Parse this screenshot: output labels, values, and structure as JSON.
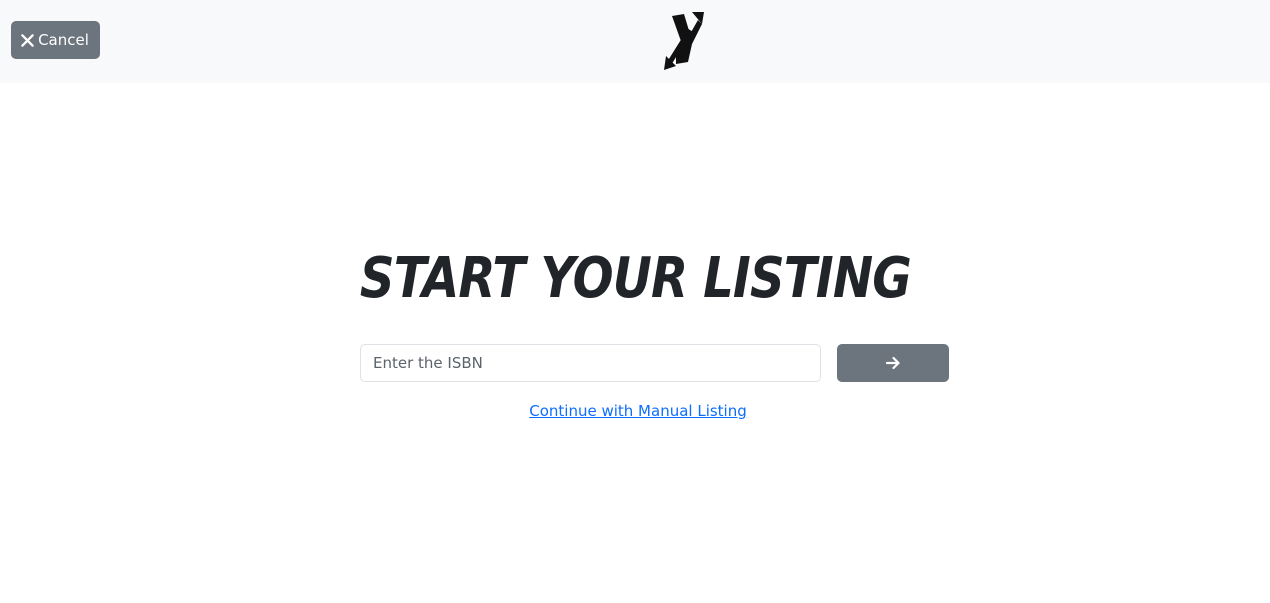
{
  "header": {
    "cancel_label": "Cancel",
    "cancel_icon": "close-icon",
    "logo_icon": "x-arrows-logo"
  },
  "main": {
    "title": "START YOUR LISTING",
    "isbn_placeholder": "Enter the ISBN",
    "isbn_value": "",
    "submit_icon": "arrow-right-icon",
    "manual_link_label": "Continue with Manual Listing"
  },
  "colors": {
    "header_bg": "#f8f9fa",
    "button_bg": "#6c757d",
    "link": "#0d6efd",
    "title": "#212529"
  }
}
